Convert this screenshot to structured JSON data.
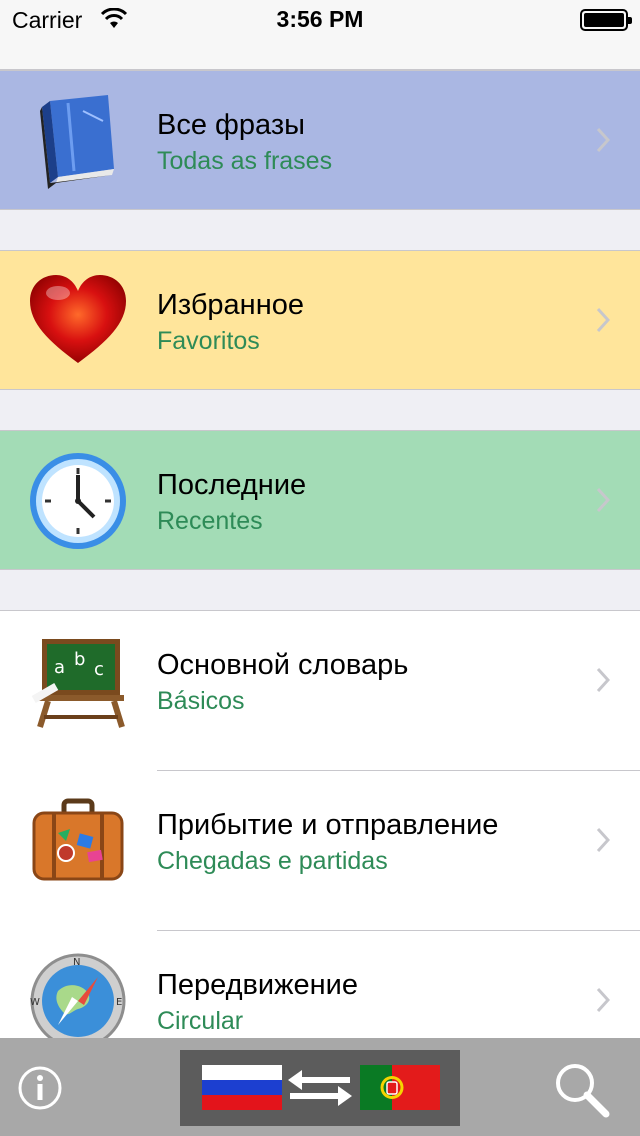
{
  "status_bar": {
    "carrier": "Carrier",
    "time": "3:56 PM"
  },
  "menu": {
    "all_phrases": {
      "title": "Все фразы",
      "subtitle": "Todas as frases",
      "icon": "book-icon",
      "color": "#aab7e3"
    },
    "favorites": {
      "title": "Избранное",
      "subtitle": "Favoritos",
      "icon": "heart-icon",
      "color": "#ffe59b"
    },
    "recents": {
      "title": "Последние",
      "subtitle": "Recentes",
      "icon": "clock-icon",
      "color": "#a3dcb6"
    }
  },
  "categories": [
    {
      "title": "Основной словарь",
      "subtitle": "Básicos",
      "icon": "chalkboard-icon"
    },
    {
      "title": "Прибытие и отправление",
      "subtitle": "Chegadas e partidas",
      "icon": "suitcase-icon"
    },
    {
      "title": "Передвижение",
      "subtitle": "Circular",
      "icon": "compass-icon"
    }
  ],
  "toolbar": {
    "info_icon": "info-icon",
    "search_icon": "magnifier-icon",
    "source_language_flag": "russia-flag-icon",
    "target_language_flag": "portugal-flag-icon",
    "swap_icon": "swap-arrows-icon"
  },
  "colors": {
    "subtitle_green": "#2e8b57",
    "toolbar_gray": "#a8a8a8"
  }
}
